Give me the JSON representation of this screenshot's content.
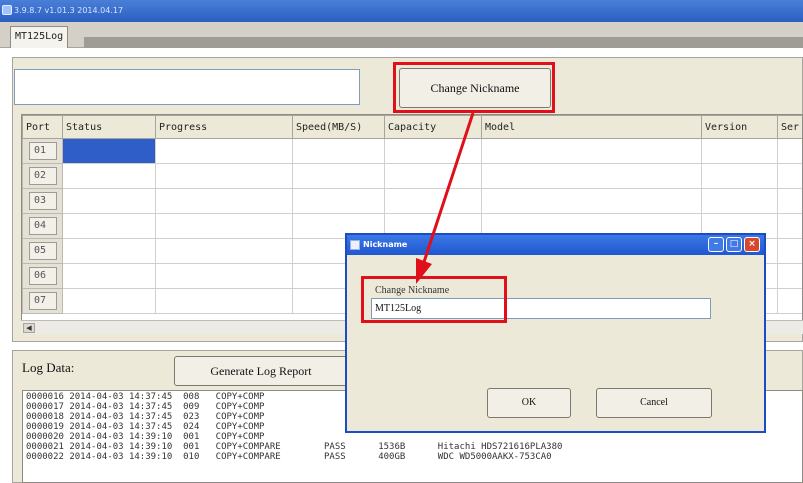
{
  "window": {
    "title": "3.9.8.7 v1.01.3 2014.04.17"
  },
  "tab": {
    "label": "MT125Log"
  },
  "top": {
    "nickname_value": "",
    "change_nickname_label": "Change Nickname"
  },
  "table": {
    "columns": [
      "Port",
      "Status",
      "Progress",
      "Speed(MB/S)",
      "Capacity",
      "Model",
      "Version",
      "Ser"
    ],
    "rows": [
      {
        "port": "01"
      },
      {
        "port": "02"
      },
      {
        "port": "03"
      },
      {
        "port": "04"
      },
      {
        "port": "05"
      },
      {
        "port": "06"
      },
      {
        "port": "07"
      }
    ]
  },
  "log": {
    "label": "Log Data:",
    "generate_label": "Generate Log Report",
    "lines": [
      "0000016 2014-04-03 14:37:45  008   COPY+COMP",
      "0000017 2014-04-03 14:37:45  009   COPY+COMP",
      "0000018 2014-04-03 14:37:45  023   COPY+COMP",
      "0000019 2014-04-03 14:37:45  024   COPY+COMP",
      "0000020 2014-04-03 14:39:10  001   COPY+COMP",
      "0000021 2014-04-03 14:39:10  001   COPY+COMPARE        PASS      1536B      Hitachi HDS721616PLA380",
      "0000022 2014-04-03 14:39:10  010   COPY+COMPARE        PASS      400GB      WDC WD5000AAKX-753CA0"
    ]
  },
  "dialog": {
    "title": "Nickname",
    "field_label": "Change Nickname",
    "field_value": "MT125Log",
    "ok_label": "OK",
    "cancel_label": "Cancel"
  },
  "colors": {
    "highlight": "#e0101a",
    "selection": "#2f5ec8",
    "titlebar": "#2b5fbf"
  }
}
